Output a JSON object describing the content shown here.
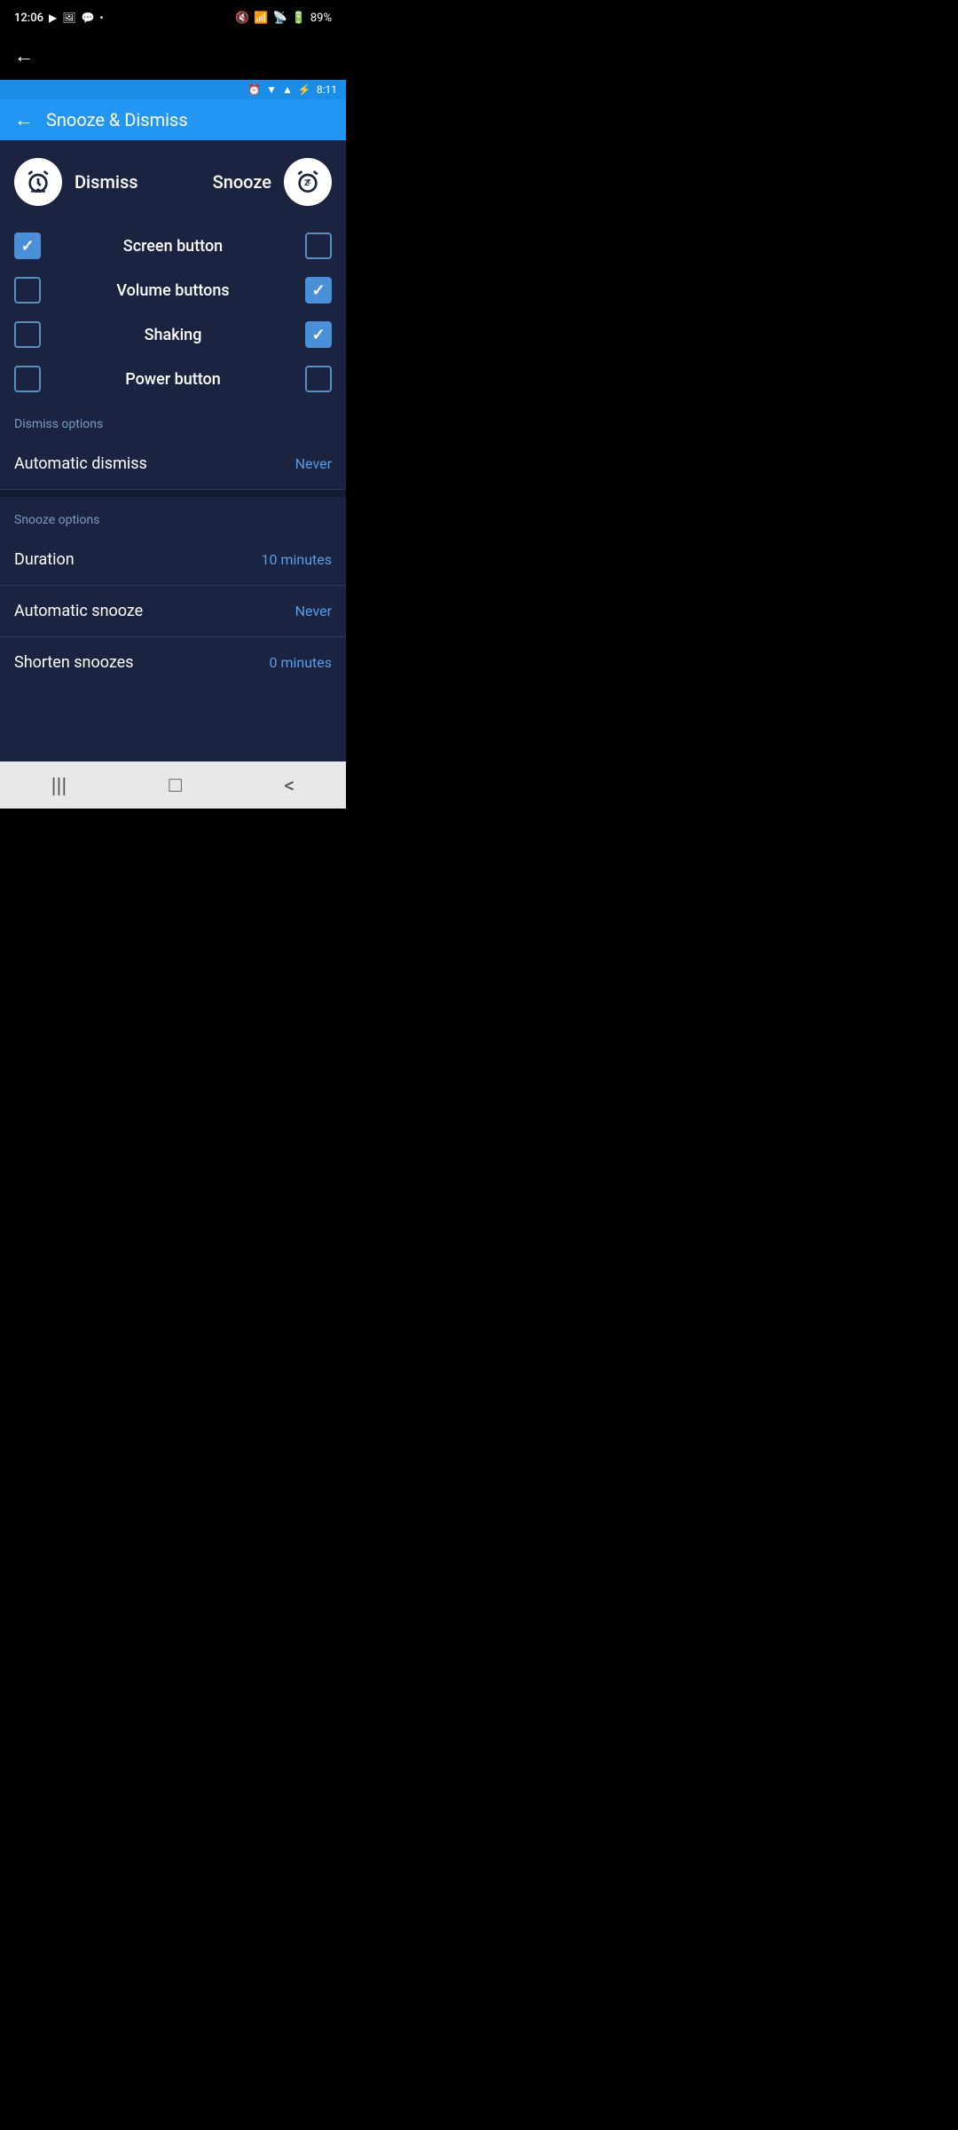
{
  "status_bar": {
    "time": "12:06",
    "battery": "89%",
    "icons": [
      "youtube",
      "image",
      "message",
      "dot"
    ]
  },
  "inner_status": {
    "time": "8:11"
  },
  "header": {
    "back_label": "←",
    "title": "Snooze & Dismiss",
    "dismiss_label": "Dismiss",
    "snooze_label": "Snooze"
  },
  "settings": [
    {
      "label": "Screen button",
      "dismiss_checked": true,
      "snooze_checked": false
    },
    {
      "label": "Volume buttons",
      "dismiss_checked": false,
      "snooze_checked": true
    },
    {
      "label": "Shaking",
      "dismiss_checked": false,
      "snooze_checked": true
    },
    {
      "label": "Power button",
      "dismiss_checked": false,
      "snooze_checked": false
    }
  ],
  "dismiss_options": {
    "section_label": "Dismiss options",
    "automatic_dismiss_label": "Automatic dismiss",
    "automatic_dismiss_value": "Never"
  },
  "snooze_options": {
    "section_label": "Snooze options",
    "duration_label": "Duration",
    "duration_value": "10 minutes",
    "automatic_snooze_label": "Automatic snooze",
    "automatic_snooze_value": "Never",
    "shorten_snoozes_label": "Shorten snoozes",
    "shorten_snoozes_value": "0 minutes"
  },
  "nav": {
    "recent_icon": "|||",
    "home_icon": "□",
    "back_icon": "<"
  }
}
